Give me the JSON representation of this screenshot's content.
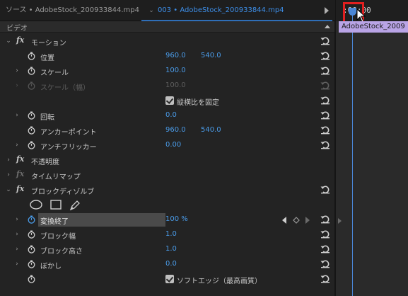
{
  "tabs": {
    "source": "ソース • AdobeStock_200933844.mp4",
    "active": "003 • AdobeStock_200933844.mp4"
  },
  "timeline": {
    "timecode": ":00:00",
    "clip_label": "AdobeStock_2009"
  },
  "section": {
    "label": "ビデオ"
  },
  "motion": {
    "title": "モーション",
    "position": {
      "label": "位置",
      "x": "960.0",
      "y": "540.0"
    },
    "scale": {
      "label": "スケール",
      "value": "100.0"
    },
    "scale_width": {
      "label": "スケール（幅）",
      "value": "100.0"
    },
    "uniform_scale": {
      "label": "縦横比を固定"
    },
    "rotation": {
      "label": "回転",
      "value": "0.0"
    },
    "anchor": {
      "label": "アンカーポイント",
      "x": "960.0",
      "y": "540.0"
    },
    "anti_flicker": {
      "label": "アンチフリッカー",
      "value": "0.00"
    }
  },
  "opacity": {
    "title": "不透明度"
  },
  "time_remap": {
    "title": "タイムリマップ"
  },
  "block_dissolve": {
    "title": "ブロックディゾルブ",
    "transition_completion": {
      "label": "変換終了",
      "value": "100 %"
    },
    "block_width": {
      "label": "ブロック幅",
      "value": "1.0"
    },
    "block_height": {
      "label": "ブロック高さ",
      "value": "1.0"
    },
    "feather": {
      "label": "ぼかし",
      "value": "0.0"
    },
    "soft_edges": {
      "label": "ソフトエッジ（最高画質）"
    }
  },
  "colors": {
    "accent": "#4a9be8",
    "clip": "#b9a4e6",
    "highlight": "#e02020"
  }
}
